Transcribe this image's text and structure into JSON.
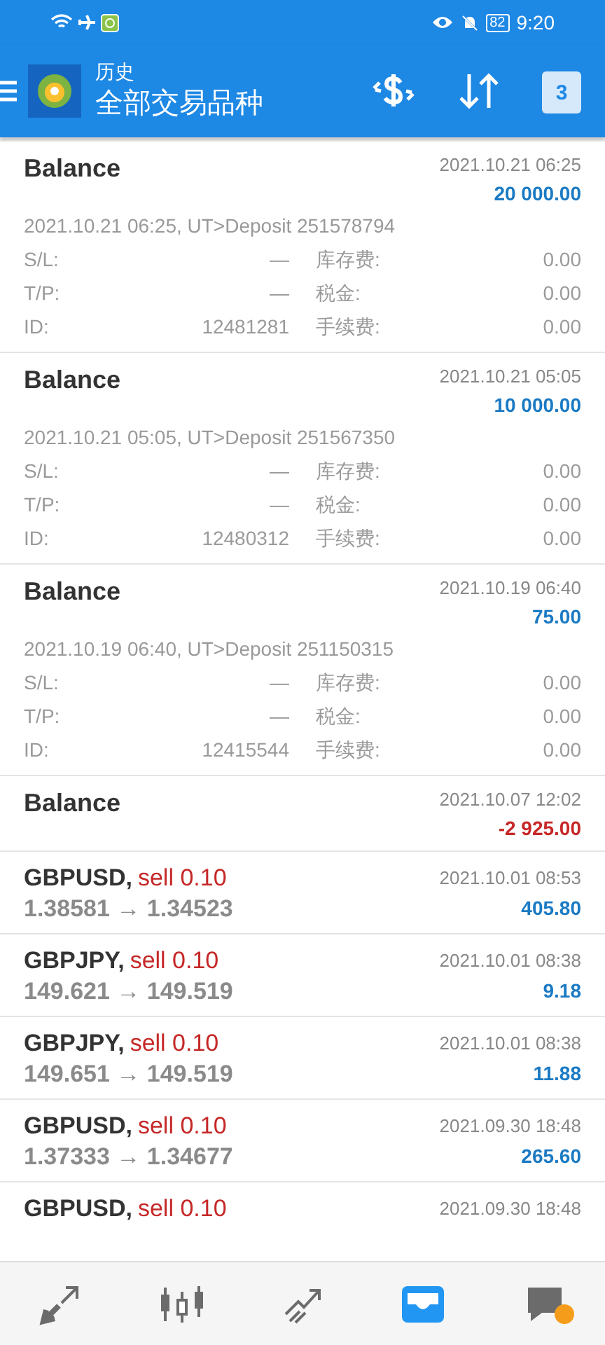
{
  "status_bar": {
    "battery": "82",
    "time": "9:20"
  },
  "header": {
    "subtitle": "历史",
    "title": "全部交易品种",
    "calendar_day": "3"
  },
  "records": [
    {
      "kind": "balance",
      "title": "Balance",
      "date": "2021.10.21 06:25",
      "amount": "20 000.00",
      "color": "#1a7ac4",
      "comment": "2021.10.21 06:25, UT>Deposit 251578794",
      "details": [
        {
          "label": "S/L:",
          "value": "—",
          "label2": "库存费:",
          "value2": "0.00"
        },
        {
          "label": "T/P:",
          "value": "—",
          "label2": "税金:",
          "value2": "0.00"
        },
        {
          "label": "ID:",
          "value": "12481281",
          "label2": "手续费:",
          "value2": "0.00"
        }
      ]
    },
    {
      "kind": "balance",
      "title": "Balance",
      "date": "2021.10.21 05:05",
      "amount": "10 000.00",
      "color": "#1a7ac4",
      "comment": "2021.10.21 05:05, UT>Deposit 251567350",
      "details": [
        {
          "label": "S/L:",
          "value": "—",
          "label2": "库存费:",
          "value2": "0.00"
        },
        {
          "label": "T/P:",
          "value": "—",
          "label2": "税金:",
          "value2": "0.00"
        },
        {
          "label": "ID:",
          "value": "12480312",
          "label2": "手续费:",
          "value2": "0.00"
        }
      ]
    },
    {
      "kind": "balance",
      "title": "Balance",
      "date": "2021.10.19 06:40",
      "amount": "75.00",
      "color": "#1a7ac4",
      "comment": "2021.10.19 06:40, UT>Deposit 251150315",
      "details": [
        {
          "label": "S/L:",
          "value": "—",
          "label2": "库存费:",
          "value2": "0.00"
        },
        {
          "label": "T/P:",
          "value": "—",
          "label2": "税金:",
          "value2": "0.00"
        },
        {
          "label": "ID:",
          "value": "12415544",
          "label2": "手续费:",
          "value2": "0.00"
        }
      ]
    },
    {
      "kind": "balance",
      "title": "Balance",
      "date": "2021.10.07 12:02",
      "amount": "-2 925.00",
      "color": "#c62828"
    },
    {
      "kind": "trade",
      "symbol": "GBPUSD,",
      "side": "sell 0.10",
      "prices": "1.38581 → 1.34523",
      "date": "2021.10.01 08:53",
      "amount": "405.80",
      "color": "#1a7ac4"
    },
    {
      "kind": "trade",
      "symbol": "GBPJPY,",
      "side": "sell 0.10",
      "prices": "149.621 → 149.519",
      "date": "2021.10.01 08:38",
      "amount": "9.18",
      "color": "#1a7ac4"
    },
    {
      "kind": "trade",
      "symbol": "GBPJPY,",
      "side": "sell 0.10",
      "prices": "149.651 → 149.519",
      "date": "2021.10.01 08:38",
      "amount": "11.88",
      "color": "#1a7ac4"
    },
    {
      "kind": "trade",
      "symbol": "GBPUSD,",
      "side": "sell 0.10",
      "prices": "1.37333 → 1.34677",
      "date": "2021.09.30 18:48",
      "amount": "265.60",
      "color": "#1a7ac4"
    },
    {
      "kind": "trade",
      "symbol": "GBPUSD,",
      "side": "sell 0.10",
      "date": "2021.09.30 18:48"
    }
  ],
  "bottom_nav": [
    {
      "kind": "quotes",
      "selected": false
    },
    {
      "kind": "chart",
      "selected": false
    },
    {
      "kind": "trade",
      "selected": false
    },
    {
      "kind": "history",
      "selected": true
    },
    {
      "kind": "messages",
      "selected": false,
      "badge": true
    }
  ]
}
